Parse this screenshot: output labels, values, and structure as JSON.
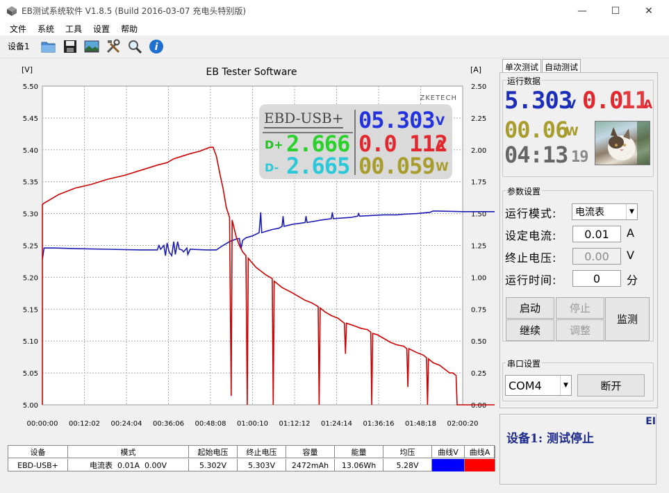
{
  "window": {
    "title": "EB测试系统软件 V1.8.5 (Build 2016-03-07 充电头特别版)",
    "minimize": "—",
    "maximize": "☐",
    "close": "✕"
  },
  "menu": [
    "文件",
    "系统",
    "工具",
    "设置",
    "帮助"
  ],
  "toolbar": {
    "device_tab": "设备1",
    "icons": [
      "folder-icon",
      "save-icon",
      "image-icon",
      "tools-icon",
      "search-icon",
      "info-icon"
    ]
  },
  "chart_data": {
    "type": "line",
    "title": "EB Tester Software",
    "ylabel_left": "[V]",
    "ylabel_right": "[A]",
    "watermark": "ZKETECH",
    "ylim_left": [
      5.0,
      5.5
    ],
    "ylim_right": [
      0.0,
      2.5
    ],
    "yticks_left": [
      "5.50",
      "5.45",
      "5.40",
      "5.35",
      "5.30",
      "5.25",
      "5.20",
      "5.15",
      "5.10",
      "5.05",
      "5.00"
    ],
    "yticks_right": [
      "2.50",
      "2.25",
      "2.00",
      "1.75",
      "1.50",
      "1.25",
      "1.00",
      "0.75",
      "0.50",
      "0.25",
      "0.00"
    ],
    "xticks": [
      "00:00:00",
      "00:12:02",
      "00:24:04",
      "00:36:06",
      "00:48:08",
      "01:00:10",
      "01:12:12",
      "01:24:14",
      "01:36:16",
      "01:48:18",
      "02:00:20"
    ],
    "xlim_minutes": [
      0,
      128
    ],
    "grid": true,
    "series": [
      {
        "color": "#1a1ab4",
        "axis": "left",
        "points": [
          [
            0,
            5.228
          ],
          [
            0.5,
            5.246
          ],
          [
            4,
            5.246
          ],
          [
            10,
            5.245
          ],
          [
            20,
            5.244
          ],
          [
            30,
            5.243
          ],
          [
            35,
            5.243
          ],
          [
            35.5,
            5.25
          ],
          [
            36,
            5.244
          ],
          [
            37,
            5.25
          ],
          [
            37.5,
            5.234
          ],
          [
            38,
            5.254
          ],
          [
            38.6,
            5.24
          ],
          [
            39.4,
            5.234
          ],
          [
            40,
            5.256
          ],
          [
            40.5,
            5.236
          ],
          [
            41.2,
            5.256
          ],
          [
            41.7,
            5.244
          ],
          [
            42.5,
            5.243
          ],
          [
            43,
            5.24
          ],
          [
            44,
            5.246
          ],
          [
            44.3,
            5.236
          ],
          [
            45,
            5.244
          ],
          [
            50,
            5.243
          ],
          [
            53,
            5.243
          ],
          [
            55,
            5.25
          ],
          [
            57,
            5.256
          ],
          [
            59,
            5.26
          ],
          [
            60,
            5.261
          ],
          [
            60.5,
            5.245
          ],
          [
            61,
            5.258
          ],
          [
            62,
            5.262
          ],
          [
            64,
            5.265
          ],
          [
            66,
            5.27
          ],
          [
            66.5,
            5.302
          ],
          [
            66.8,
            5.27
          ],
          [
            68,
            5.272
          ],
          [
            70,
            5.275
          ],
          [
            72,
            5.277
          ],
          [
            73,
            5.28
          ],
          [
            73.3,
            5.296
          ],
          [
            73.6,
            5.28
          ],
          [
            76,
            5.283
          ],
          [
            80,
            5.286
          ],
          [
            80.3,
            5.296
          ],
          [
            80.6,
            5.286
          ],
          [
            85,
            5.29
          ],
          [
            88,
            5.292
          ],
          [
            88.3,
            5.302
          ],
          [
            88.6,
            5.292
          ],
          [
            94,
            5.294
          ],
          [
            96,
            5.296
          ],
          [
            96.3,
            5.3
          ],
          [
            96.6,
            5.296
          ],
          [
            100,
            5.297
          ],
          [
            104,
            5.298
          ],
          [
            108,
            5.298
          ],
          [
            110,
            5.299
          ],
          [
            114,
            5.3
          ],
          [
            118,
            5.302
          ],
          [
            119,
            5.304
          ],
          [
            120,
            5.304
          ],
          [
            128,
            5.303
          ]
        ]
      },
      {
        "color": "#cc0000",
        "axis": "right",
        "points": [
          [
            0,
            0
          ],
          [
            0,
            1.57
          ],
          [
            0.4,
            1.58
          ],
          [
            5,
            1.65
          ],
          [
            10,
            1.7
          ],
          [
            15,
            1.73
          ],
          [
            20,
            1.77
          ],
          [
            25,
            1.8
          ],
          [
            30,
            1.84
          ],
          [
            35,
            1.88
          ],
          [
            38,
            1.9
          ],
          [
            40,
            1.93
          ],
          [
            45,
            1.97
          ],
          [
            48,
            1.99
          ],
          [
            51,
            2.02
          ],
          [
            52,
            2.02
          ],
          [
            53,
            1.95
          ],
          [
            54,
            1.82
          ],
          [
            55,
            1.7
          ],
          [
            56,
            1.55
          ],
          [
            57,
            1.47
          ],
          [
            57.5,
            0.07
          ],
          [
            57.8,
            1.45
          ],
          [
            59,
            1.32
          ],
          [
            60,
            1.25
          ],
          [
            61,
            1.2
          ],
          [
            62,
            1.17
          ],
          [
            62.4,
            0.0
          ],
          [
            62.7,
            1.15
          ],
          [
            65,
            1.08
          ],
          [
            68,
            1.02
          ],
          [
            70,
            0.99
          ],
          [
            70.3,
            0.0
          ],
          [
            70.6,
            0.97
          ],
          [
            73,
            0.92
          ],
          [
            76,
            0.88
          ],
          [
            78,
            0.85
          ],
          [
            80,
            0.82
          ],
          [
            82,
            0.8
          ],
          [
            84,
            0.77
          ],
          [
            84.3,
            0.0
          ],
          [
            84.6,
            0.76
          ],
          [
            86,
            0.73
          ],
          [
            88,
            0.7
          ],
          [
            90,
            0.68
          ],
          [
            92,
            0.64
          ],
          [
            92.3,
            0.4
          ],
          [
            92.6,
            0.64
          ],
          [
            95,
            0.62
          ],
          [
            97,
            0.6
          ],
          [
            99,
            0.59
          ],
          [
            100,
            0.57
          ],
          [
            100.3,
            0.0
          ],
          [
            100.6,
            0.56
          ],
          [
            102,
            0.55
          ],
          [
            104,
            0.52
          ],
          [
            106,
            0.49
          ],
          [
            108,
            0.47
          ],
          [
            110,
            0.46
          ],
          [
            111,
            0.44
          ],
          [
            111.3,
            0.14
          ],
          [
            111.6,
            0.44
          ],
          [
            114,
            0.41
          ],
          [
            116,
            0.39
          ],
          [
            117,
            0.37
          ],
          [
            117.3,
            0.0
          ],
          [
            117.6,
            0.36
          ],
          [
            119,
            0.33
          ],
          [
            121,
            0.31
          ],
          [
            123,
            0.27
          ],
          [
            124,
            0.25
          ],
          [
            125,
            0.25
          ],
          [
            126,
            0.23
          ],
          [
            126.3,
            0.0
          ],
          [
            128,
            0.0
          ]
        ]
      }
    ]
  },
  "lcd_overlay": {
    "device_name": "EBD-USB+",
    "voltage": "05.303",
    "voltage_unit": "V",
    "current": "0.0 112",
    "current_unit": "A",
    "power": "00.059",
    "power_unit": "W",
    "dplus_label": "D+",
    "dplus": "2.666",
    "dminus_label": "D-",
    "dminus": "2.665"
  },
  "right_panel": {
    "tabs": [
      "单次测试",
      "自动测试"
    ],
    "run_data_title": "运行数据",
    "voltage": "5.303",
    "voltage_unit": "V",
    "current": "0.0",
    "current_dim": "11",
    "current_unit": "A",
    "power": "00.06",
    "power_unit": "W",
    "time_main": "04:13",
    "time_sec": "19",
    "params_title": "参数设置",
    "mode_label": "运行模式:",
    "mode_value": "电流表",
    "set_current_label": "设定电流:",
    "set_current_value": "0.01",
    "set_current_unit": "A",
    "cutoff_voltage_label": "终止电压:",
    "cutoff_voltage_value": "0.00",
    "cutoff_voltage_unit": "V",
    "run_time_label": "运行时间:",
    "run_time_value": "0",
    "run_time_unit": "分",
    "buttons": {
      "start": "启动",
      "stop": "停止",
      "monitor": "监测",
      "continue": "继续",
      "adjust": "调整"
    },
    "serial_title": "串口设置",
    "com_port": "COM4",
    "disconnect": "断开",
    "status_text": "设备1: 测试停止",
    "status_corner": "EI"
  },
  "table": {
    "headers": [
      "设备",
      "模式",
      "起始电压",
      "终止电压",
      "容量",
      "能量",
      "均压",
      "曲线V",
      "曲线A"
    ],
    "row": [
      "EBD-USB+",
      "电流表  0.01A  0.00V",
      "5.302V",
      "5.303V",
      "2472mAh",
      "13.06Wh",
      "5.28V",
      "",
      ""
    ],
    "curve_v_color": "#0000ff",
    "curve_a_color": "#ff0000"
  }
}
